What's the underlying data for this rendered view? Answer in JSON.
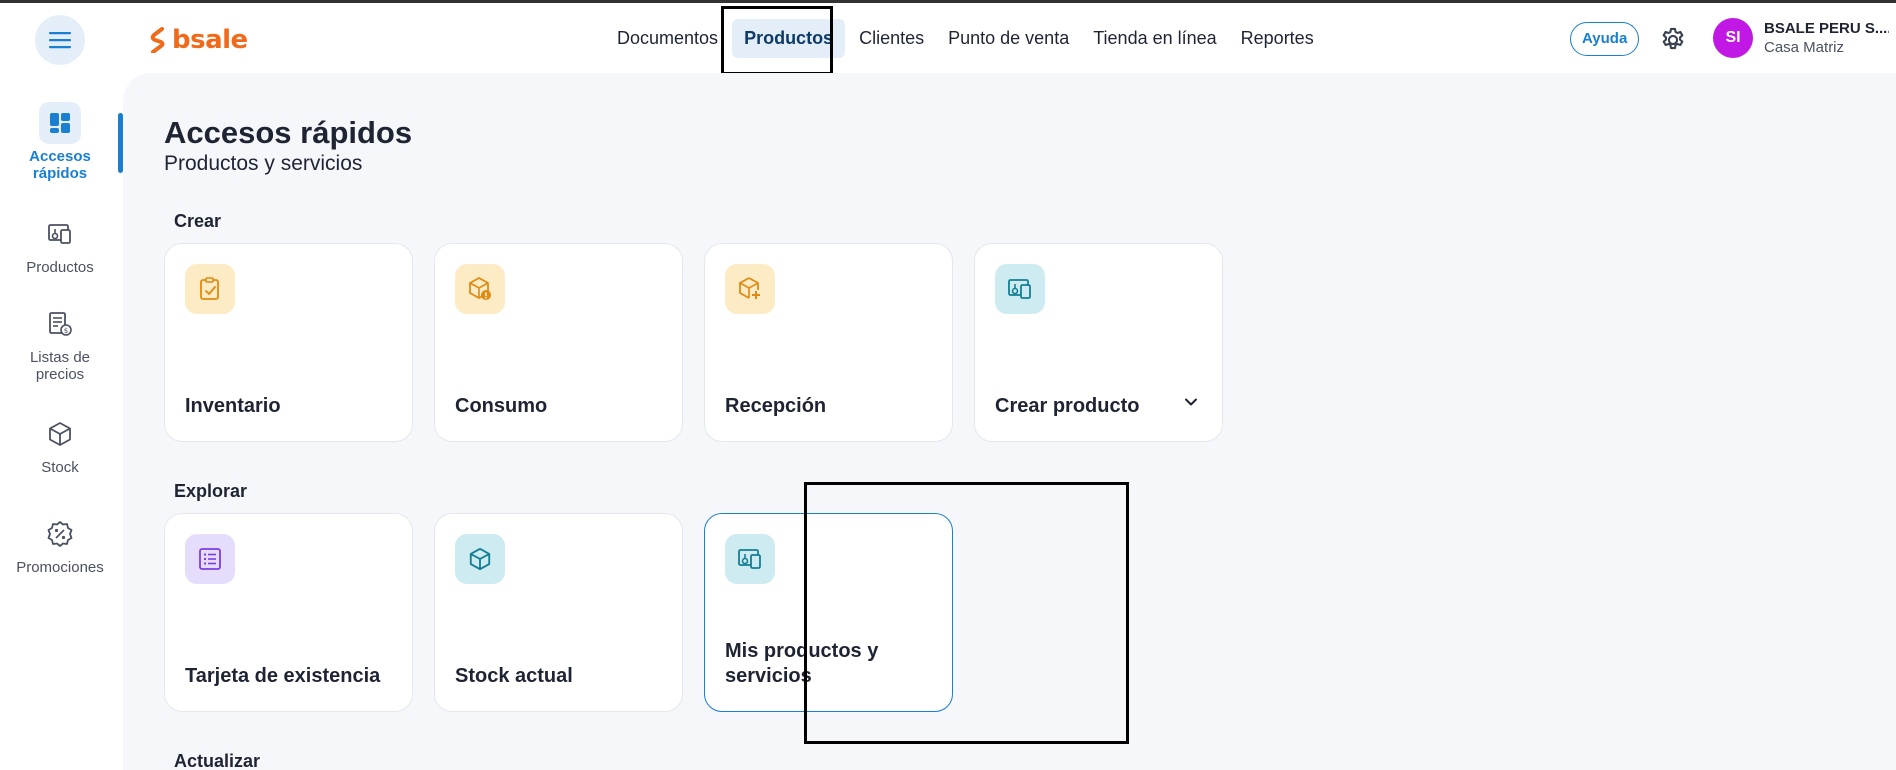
{
  "app": {
    "brand": "bsale"
  },
  "header": {
    "nav": [
      {
        "label": "Documentos"
      },
      {
        "label": "Productos",
        "active": true
      },
      {
        "label": "Clientes"
      },
      {
        "label": "Punto de venta"
      },
      {
        "label": "Tienda en línea"
      },
      {
        "label": "Reportes"
      }
    ],
    "help_label": "Ayuda",
    "avatar_initials": "SI",
    "company_name": "BSALE PERU S....",
    "branch": "Casa Matriz"
  },
  "sidebar": {
    "items": [
      {
        "label": "Accesos rápidos",
        "icon": "dashboard-icon",
        "active": true
      },
      {
        "label": "Productos",
        "icon": "product-icon"
      },
      {
        "label": "Listas de precios",
        "icon": "price-list-icon"
      },
      {
        "label": "Stock",
        "icon": "cube-icon"
      },
      {
        "label": "Promociones",
        "icon": "discount-icon"
      }
    ]
  },
  "main": {
    "title": "Accesos rápidos",
    "subtitle": "Productos y servicios",
    "sections": {
      "crear": {
        "label": "Crear",
        "cards": [
          {
            "label": "Inventario",
            "icon": "clipboard-check-icon"
          },
          {
            "label": "Consumo",
            "icon": "box-alert-icon"
          },
          {
            "label": "Recepción",
            "icon": "box-plus-icon"
          },
          {
            "label": "Crear producto",
            "icon": "product-icon",
            "has_dropdown": true
          }
        ]
      },
      "explorar": {
        "label": "Explorar",
        "cards": [
          {
            "label": "Tarjeta de existencia",
            "icon": "list-icon"
          },
          {
            "label": "Stock actual",
            "icon": "cube-icon"
          },
          {
            "label": "Mis productos y servicios",
            "icon": "product-icon",
            "selected": true
          }
        ]
      },
      "actualizar": {
        "label": "Actualizar"
      }
    }
  },
  "colors": {
    "brand": "#f06a1b",
    "accent": "#1a7fd0",
    "avatar": "#c118e5",
    "orange_icon_bg": "#fdebc5",
    "teal_icon_bg": "#cdebf0",
    "purple_icon_bg": "#e6dcfb"
  }
}
